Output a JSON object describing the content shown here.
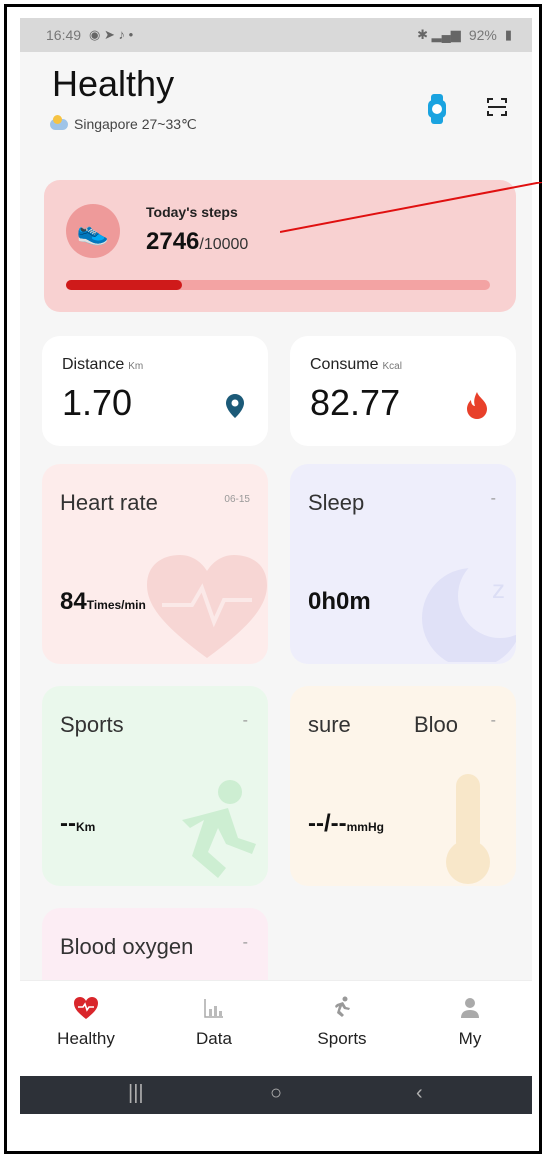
{
  "status": {
    "time": "16:49",
    "battery": "92%"
  },
  "header": {
    "title": "Healthy",
    "weather": "Singapore 27~33℃"
  },
  "icons": {
    "watch": "watch-icon",
    "scan": "scan-icon"
  },
  "steps": {
    "label": "Today's steps",
    "value": "2746",
    "goal": "/10000",
    "progress": 0.2746
  },
  "distance": {
    "label": "Distance",
    "unit": "Km",
    "value": "1.70"
  },
  "consume": {
    "label": "Consume",
    "unit": "Kcal",
    "value": "82.77"
  },
  "heart": {
    "title": "Heart rate",
    "date": "06-15",
    "value": "84",
    "unit": "Times/min"
  },
  "sleep": {
    "title": "Sleep",
    "dash": "-",
    "value": "0h0m"
  },
  "sports": {
    "title": "Sports",
    "dash": "-",
    "value": "--",
    "unit": "Km"
  },
  "pressure": {
    "title_a": "sure",
    "title_b": "Bloo",
    "dash": "-",
    "value": "--/--",
    "unit": "mmHg"
  },
  "oxygen": {
    "title": "Blood oxygen",
    "dash": "-"
  },
  "nav": {
    "items": [
      {
        "label": "Healthy"
      },
      {
        "label": "Data"
      },
      {
        "label": "Sports"
      },
      {
        "label": "My"
      }
    ]
  },
  "colors": {
    "accent": "#cf1a1a",
    "steps_bg": "#f8d1d1",
    "nav_bar": "#2d3138"
  }
}
